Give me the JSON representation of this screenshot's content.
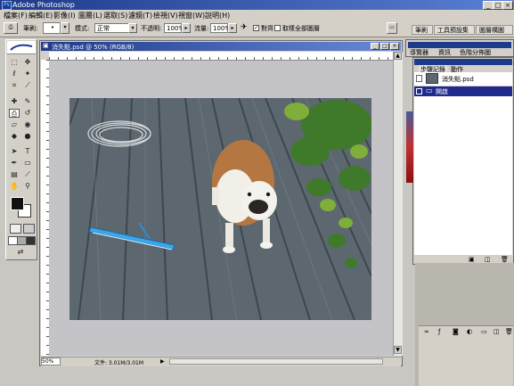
{
  "app": {
    "title": "Adobe Photoshop",
    "icon_text": "Ps"
  },
  "window_controls": {
    "minimize": "_",
    "maximize": "□",
    "close": "×"
  },
  "menu": [
    "檔案(F)",
    "編輯(E)",
    "影像(I)",
    "圖層(L)",
    "選取(S)",
    "濾鏡(T)",
    "檢視(V)",
    "視窗(W)",
    "說明(H)"
  ],
  "options": {
    "brush_label": "筆刷:",
    "brush_size": "•",
    "mode_label": "模式:",
    "mode_value": "正常",
    "opacity_label": "不透明:",
    "opacity_value": "100%",
    "flow_label": "流量:",
    "flow_value": "100%",
    "aligned_label": "對齊",
    "aligned_checked": "✓",
    "sample_all_label": "取樣全部圖層",
    "sample_all_checked": ""
  },
  "palette_well": {
    "tabs": [
      "筆刷",
      "工具預設集",
      "圖層構圖"
    ]
  },
  "document": {
    "title": "消失點.psd @ 50% (RGB/8)",
    "zoom": "50%",
    "file_info": "文件: 3.01M/3.01M"
  },
  "navigator_panel": {
    "tabs": [
      "導覽器",
      "資訊",
      "色階分佈圖"
    ]
  },
  "history_panel": {
    "tabs": [
      "步驟記錄",
      "動作"
    ],
    "snapshot_label": "消失點.psd",
    "items": [
      "開啟"
    ]
  },
  "colors": {
    "title_start": "#1e3a8a",
    "title_end": "#5a7fd4",
    "history_selected": "#1f2a8c",
    "deck": "#5c6770"
  }
}
